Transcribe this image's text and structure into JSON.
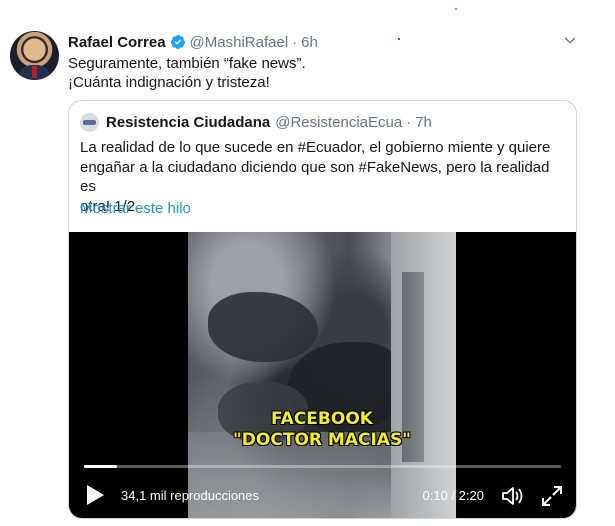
{
  "tweet": {
    "author_name": "Rafael Correa",
    "author_handle": "@MashiRafael",
    "separator": "·",
    "time": "6h",
    "text_line1": "Seguramente, también “fake news”.",
    "text_line2": "¡Cuánta indignación y tristeza!"
  },
  "quoted": {
    "author_name": "Resistencia Ciudadana",
    "author_handle": "@ResistenciaEcua",
    "separator": "·",
    "time": "7h",
    "text_line1": "La realidad de lo que sucede en #Ecuador, el gobierno miente y quiere",
    "text_line2": "engañar a la ciudadano diciendo que son #FakeNews, pero la realidad es",
    "text_line3": "otra! 1/2",
    "show_thread_link": "Mostrar este hilo"
  },
  "video": {
    "watermark_line1": "FACEBOOK",
    "watermark_line2": "\"DOCTOR MACIAS\"",
    "views": "34,1 mil reproducciones",
    "timecode": "0:10 / 2:20",
    "progress": 0.07
  },
  "colors": {
    "accent": "#1b95e0",
    "verified": "#1da1f2",
    "muted": "#657786",
    "watermark": "#f2ee2b"
  },
  "icons": {
    "verified": "verified-badge-icon",
    "caret": "chevron-down-icon",
    "play": "play-icon",
    "volume": "volume-icon",
    "fullscreen": "fullscreen-icon"
  }
}
